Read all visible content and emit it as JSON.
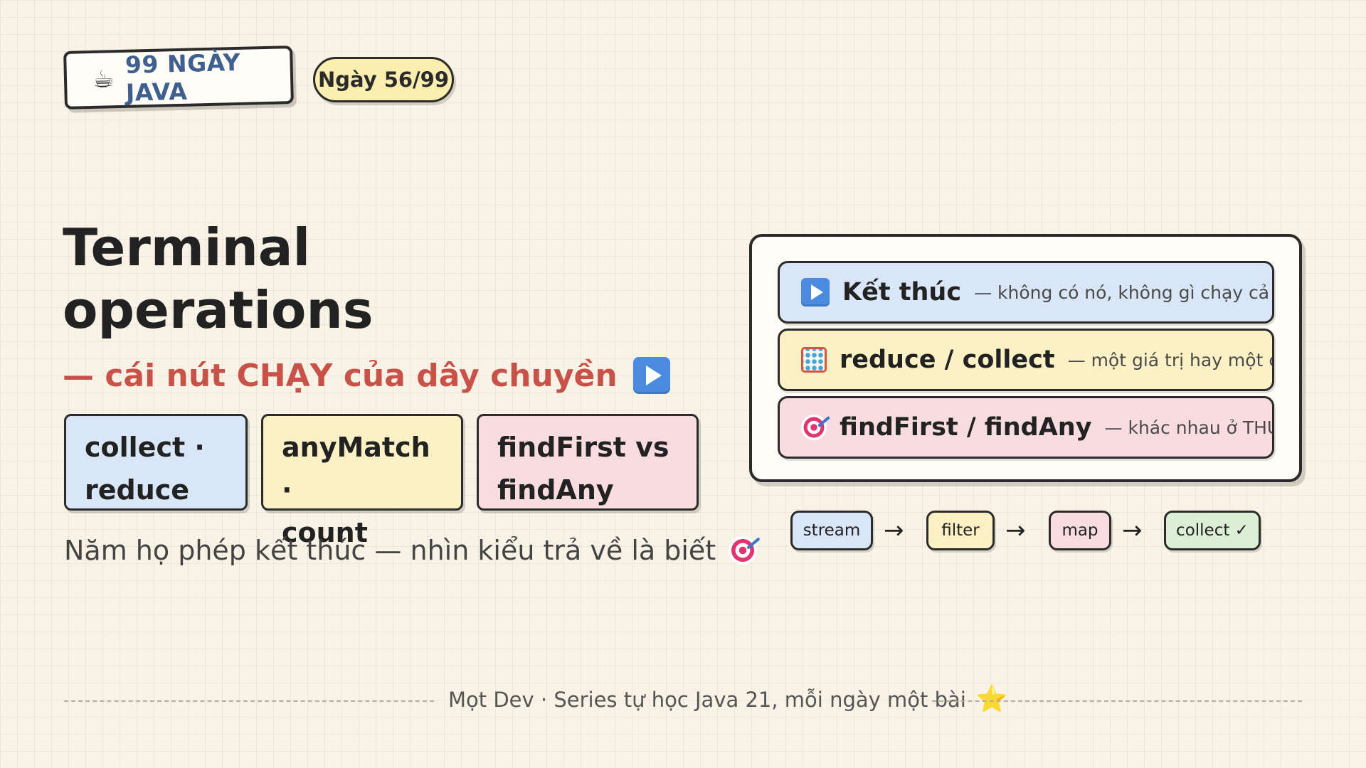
{
  "header": {
    "brand_icon": "coffee-cup-icon",
    "brand_label": "99 NGÀY JAVA",
    "day_label": "Ngày 56/99"
  },
  "hero": {
    "title_line1": "Terminal",
    "title_line2": "operations",
    "subtitle": "— cái nút CHẠY của dây chuyền",
    "subtitle_icon": "play-button-icon"
  },
  "topics": [
    {
      "line1": "collect ·",
      "line2": "reduce",
      "color": "#d8e6f7"
    },
    {
      "line1": "anyMatch ·",
      "line2": "count",
      "color": "#fbf1c4"
    },
    {
      "line1": "findFirst vs",
      "line2": "findAny",
      "color": "#f8dce0"
    }
  ],
  "tagline": "Năm họ phép kết thúc — nhìn kiểu trả về là biết",
  "panel": {
    "rows": [
      {
        "icon": "play-button-icon",
        "title": "Kết thúc",
        "desc": "— không có nó, không gì chạy cả",
        "color": "#d8e6f7"
      },
      {
        "icon": "abacus-icon",
        "title": "reduce / collect",
        "desc": "— một giá trị hay một container",
        "color": "#fbf1c4"
      },
      {
        "icon": "target-icon",
        "title": "findFirst / findAny",
        "desc": "— khác nhau ở THỨ TỰ",
        "color": "#f8dce0"
      }
    ]
  },
  "pipeline": {
    "nodes": [
      "stream",
      "filter",
      "map",
      "collect ✓"
    ],
    "arrow": "→"
  },
  "footer": {
    "text": "Mọt Dev · Series tự học Java 21, mỗi ngày một bài",
    "icon": "star-icon",
    "star": "⭐"
  },
  "colors": {
    "background": "#f8f3e6",
    "accent_red": "#c95248",
    "brand_blue": "#3f5f8f",
    "pill_yellow": "#fbefb0",
    "blue": "#d8e6f7",
    "yellow": "#fbf1c4",
    "pink": "#f8dce0",
    "green": "#ddeed6"
  }
}
